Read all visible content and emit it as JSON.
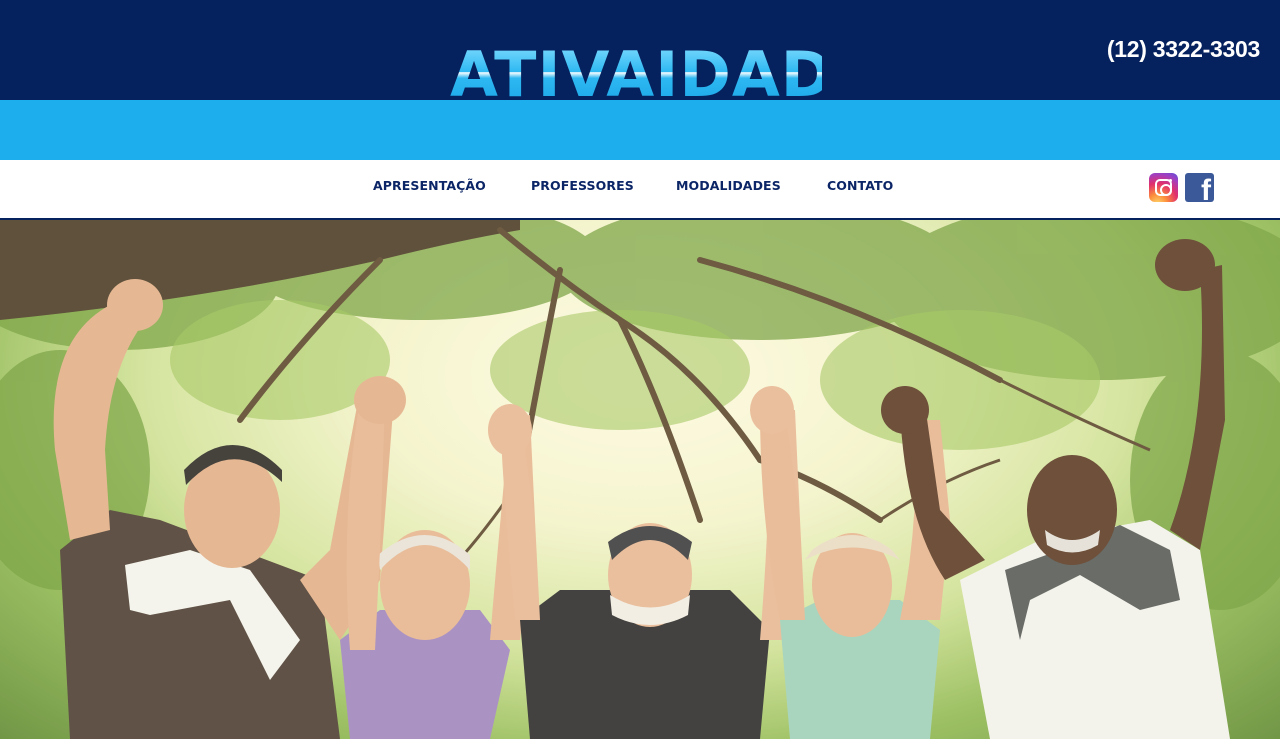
{
  "header": {
    "logo_text": "ATIVAIDADE",
    "phone": "(12) 3322-3303"
  },
  "nav": {
    "items": [
      {
        "label": "APRESENTAÇÃO"
      },
      {
        "label": "PROFESSORES"
      },
      {
        "label": "MODALIDADES"
      },
      {
        "label": "CONTATO"
      }
    ],
    "social": [
      {
        "icon": "instagram-icon"
      },
      {
        "icon": "facebook-icon"
      }
    ]
  },
  "hero": {
    "image": "hero-image"
  },
  "colors": {
    "dark_blue": "#06225e",
    "light_blue": "#1daeed",
    "nav_text": "#0b2566"
  }
}
